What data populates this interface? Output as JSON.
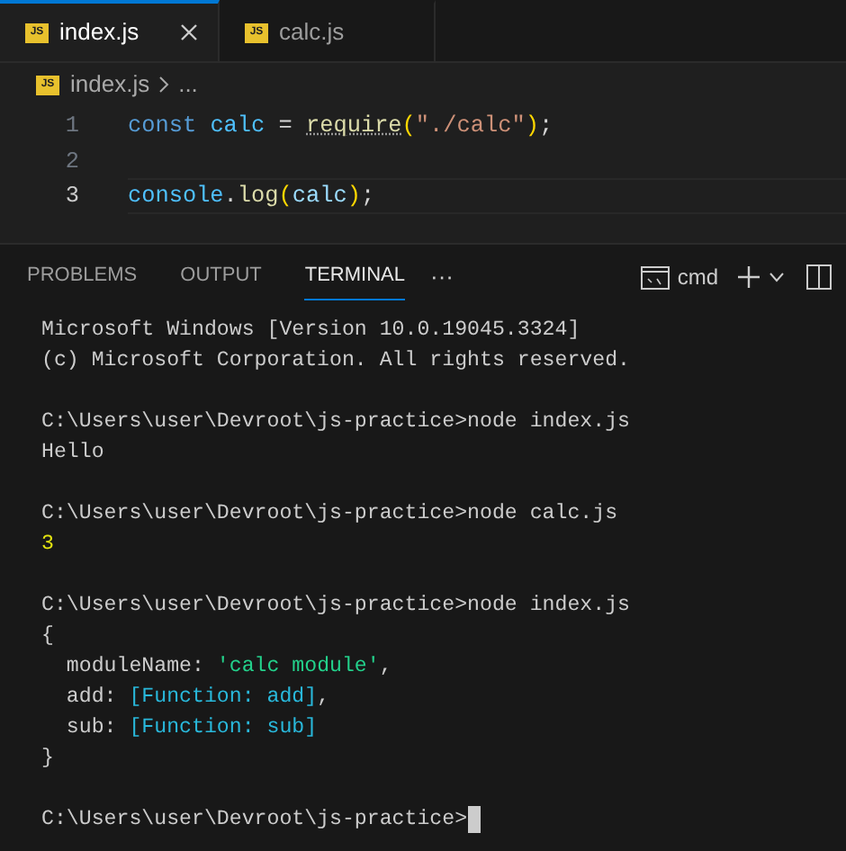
{
  "tabs": [
    {
      "badge": "JS",
      "label": "index.js",
      "selected": true,
      "closable": true
    },
    {
      "badge": "JS",
      "label": "calc.js",
      "selected": false,
      "closable": false
    }
  ],
  "breadcrumb": {
    "badge": "JS",
    "file": "index.js",
    "trail": "..."
  },
  "editor": {
    "lines": [
      {
        "number": "1",
        "current": false,
        "tokens": [
          {
            "text": "const",
            "kind": "keyword"
          },
          {
            "text": " calc",
            "kind": "constant"
          },
          {
            "text": " = "
          },
          {
            "text": "require",
            "kind": "function",
            "hint": true
          },
          {
            "text": "(",
            "kind": "bracket"
          },
          {
            "text": "\"./calc\"",
            "kind": "string"
          },
          {
            "text": ")",
            "kind": "bracket"
          },
          {
            "text": ";"
          }
        ]
      },
      {
        "number": "2",
        "current": false
      },
      {
        "number": "3",
        "current": true,
        "tokens": [
          {
            "text": "console",
            "kind": "constant"
          },
          {
            "text": "."
          },
          {
            "text": "log",
            "kind": "function"
          },
          {
            "text": "(",
            "kind": "bracket"
          },
          {
            "text": "calc",
            "kind": "variable"
          },
          {
            "text": ")",
            "kind": "bracket"
          },
          {
            "text": ";"
          }
        ]
      }
    ]
  },
  "panel": {
    "tabs": [
      {
        "label": "PROBLEMS",
        "selected": false
      },
      {
        "label": "OUTPUT",
        "selected": false
      },
      {
        "label": "TERMINAL",
        "selected": true
      }
    ],
    "more": "···",
    "profile": "cmd",
    "terminal": {
      "blocks": [
        [
          {
            "segments": [
              {
                "text": "Microsoft Windows [Version 10.0.19045.3324]"
              }
            ]
          },
          {
            "segments": [
              {
                "text": "(c) Microsoft Corporation. All rights reserved."
              }
            ]
          }
        ],
        [
          {
            "segments": [
              {
                "text": "C:\\Users\\user\\Devroot\\js-practice>node index.js"
              }
            ]
          },
          {
            "segments": [
              {
                "text": "Hello"
              }
            ]
          }
        ],
        [
          {
            "segments": [
              {
                "text": "C:\\Users\\user\\Devroot\\js-practice>node calc.js"
              }
            ]
          },
          {
            "segments": [
              {
                "text": "3",
                "kind": "number"
              }
            ]
          }
        ],
        [
          {
            "segments": [
              {
                "text": "C:\\Users\\user\\Devroot\\js-practice>node index.js"
              }
            ]
          },
          {
            "segments": [
              {
                "text": "{"
              }
            ]
          },
          {
            "segments": [
              {
                "text": "  moduleName: "
              },
              {
                "text": "'calc module'",
                "kind": "string"
              },
              {
                "text": ","
              }
            ]
          },
          {
            "segments": [
              {
                "text": "  add: "
              },
              {
                "text": "[Function: add]",
                "kind": "function"
              },
              {
                "text": ","
              }
            ]
          },
          {
            "segments": [
              {
                "text": "  sub: "
              },
              {
                "text": "[Function: sub]",
                "kind": "function"
              }
            ]
          },
          {
            "segments": [
              {
                "text": "}"
              }
            ]
          }
        ],
        [
          {
            "segments": [
              {
                "text": "C:\\Users\\user\\Devroot\\js-practice>"
              }
            ],
            "cursor": true
          }
        ]
      ]
    }
  }
}
